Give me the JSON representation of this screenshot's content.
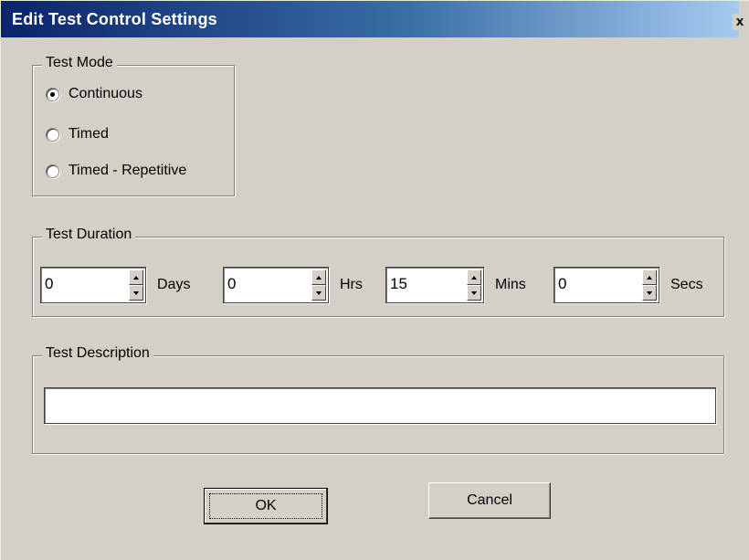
{
  "dialog": {
    "title": "Edit Test Control Settings",
    "close_glyph": "x"
  },
  "test_mode": {
    "legend": "Test Mode",
    "options": [
      {
        "label": "Continuous",
        "selected": true
      },
      {
        "label": "Timed",
        "selected": false
      },
      {
        "label": "Timed - Repetitive",
        "selected": false
      }
    ]
  },
  "test_duration": {
    "legend": "Test Duration",
    "fields": [
      {
        "value": "0",
        "unit": "Days"
      },
      {
        "value": "0",
        "unit": "Hrs"
      },
      {
        "value": "15",
        "unit": "Mins"
      },
      {
        "value": "0",
        "unit": "Secs"
      }
    ]
  },
  "test_description": {
    "legend": "Test Description",
    "value": ""
  },
  "buttons": {
    "ok": "OK",
    "cancel": "Cancel"
  },
  "colors": {
    "dialog_bg": "#d4d0c8",
    "titlebar_start": "#0a246a",
    "titlebar_end": "#a6caf0",
    "title_text": "#ffffff"
  }
}
